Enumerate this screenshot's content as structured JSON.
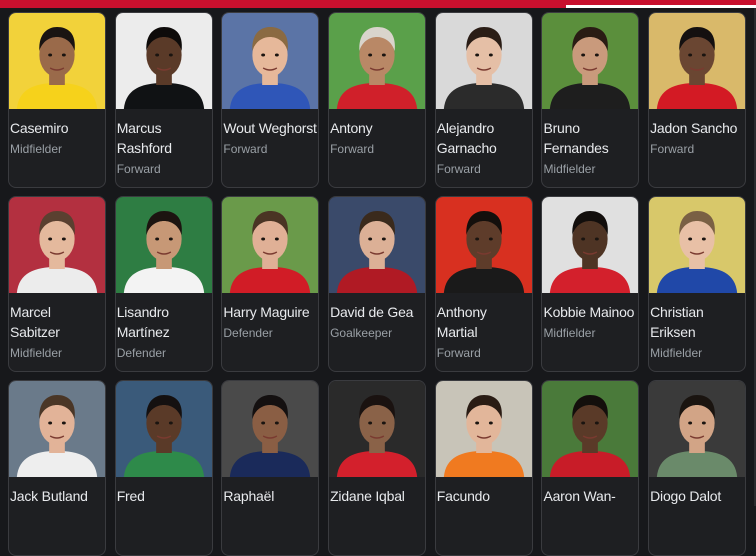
{
  "players": [
    {
      "name": "Casemiro",
      "position": "Midfielder",
      "bg": "#f2d23a",
      "shirt": "#f6d21b",
      "skin": "#9a6a4a",
      "hair": "#1a1412"
    },
    {
      "name": "Marcus Rashford",
      "position": "Forward",
      "bg": "#ececec",
      "shirt": "#101214",
      "skin": "#5a3a28",
      "hair": "#0e0b0a"
    },
    {
      "name": "Wout Weghorst",
      "position": "Forward",
      "bg": "#5b74a6",
      "shirt": "#2f56b8",
      "skin": "#e6b89a",
      "hair": "#8a6a42"
    },
    {
      "name": "Antony",
      "position": "Forward",
      "bg": "#5aa04a",
      "shirt": "#d0202a",
      "skin": "#b98866",
      "hair": "#d9d4cc"
    },
    {
      "name": "Alejandro Garnacho",
      "position": "Forward",
      "bg": "#d9d9d9",
      "shirt": "#2b2b2b",
      "skin": "#e5bfa6",
      "hair": "#2a1d16"
    },
    {
      "name": "Bruno Fernandes",
      "position": "Midfielder",
      "bg": "#5b8f3c",
      "shirt": "#1e1e1e",
      "skin": "#c99a7c",
      "hair": "#2a1c14"
    },
    {
      "name": "Jadon Sancho",
      "position": "Forward",
      "bg": "#d9b96a",
      "shirt": "#d31a24",
      "skin": "#6a4632",
      "hair": "#141010"
    },
    {
      "name": "Marcel Sabitzer",
      "position": "Midfielder",
      "bg": "#b33040",
      "shirt": "#ececec",
      "skin": "#e4b99d",
      "hair": "#5a4030"
    },
    {
      "name": "Lisandro Martínez",
      "position": "Defender",
      "bg": "#2e7d43",
      "shirt": "#f3f3f3",
      "skin": "#c79876",
      "hair": "#1c1410"
    },
    {
      "name": "Harry Maguire",
      "position": "Defender",
      "bg": "#6a9a4a",
      "shirt": "#d11c26",
      "skin": "#e0b096",
      "hair": "#4a3424"
    },
    {
      "name": "David de Gea",
      "position": "Goalkeeper",
      "bg": "#3a4a6a",
      "shirt": "#b01a24",
      "skin": "#dcb096",
      "hair": "#3a2a1c"
    },
    {
      "name": "Anthony Martial",
      "position": "Forward",
      "bg": "#d83020",
      "shirt": "#1a1a1a",
      "skin": "#5e3c2a",
      "hair": "#140f0c"
    },
    {
      "name": "Kobbie Mainoo",
      "position": "Midfielder",
      "bg": "#e0e0e0",
      "shirt": "#d3202c",
      "skin": "#4e3424",
      "hair": "#120e0c"
    },
    {
      "name": "Christian Eriksen",
      "position": "Midfielder",
      "bg": "#d8c86a",
      "shirt": "#2048a8",
      "skin": "#e8c0a6",
      "hair": "#7a6044"
    },
    {
      "name": "Jack Butland",
      "position": "",
      "bg": "#6a7a8a",
      "shirt": "#eeeeee",
      "skin": "#e2b398",
      "hair": "#4a3626"
    },
    {
      "name": "Fred",
      "position": "",
      "bg": "#3a5a7a",
      "shirt": "#2e8a4a",
      "skin": "#5a3a28",
      "hair": "#141010"
    },
    {
      "name": "Raphaël",
      "position": "",
      "bg": "#4a4a4a",
      "shirt": "#1a2a5a",
      "skin": "#8a5e44",
      "hair": "#141010"
    },
    {
      "name": "Zidane Iqbal",
      "position": "",
      "bg": "#2a2a2a",
      "shirt": "#d3202c",
      "skin": "#8a6248",
      "hair": "#1a1210"
    },
    {
      "name": "Facundo",
      "position": "",
      "bg": "#c8c4b8",
      "shirt": "#f07a20",
      "skin": "#e2b69a",
      "hair": "#2a1c14"
    },
    {
      "name": "Aaron Wan-",
      "position": "",
      "bg": "#4a7a3a",
      "shirt": "#c81c28",
      "skin": "#5a3a28",
      "hair": "#140f0c"
    },
    {
      "name": "Diogo Dalot",
      "position": "",
      "bg": "#3a3a3a",
      "shirt": "#6a8a6a",
      "skin": "#d2a486",
      "hair": "#1a1410"
    }
  ]
}
